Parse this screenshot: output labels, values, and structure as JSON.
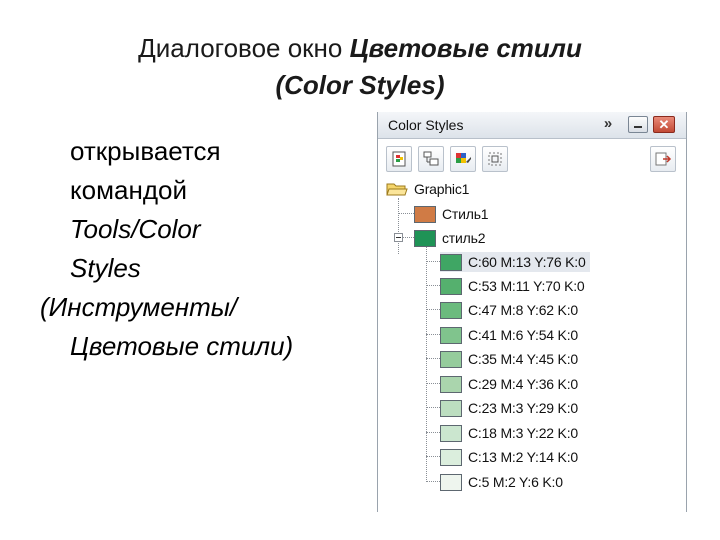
{
  "slide": {
    "title_prefix": "Диалоговое окно ",
    "title_italic": "Цветовые стили",
    "title_line2": "(Color Styles)",
    "body": [
      {
        "text": "открывается",
        "style": "normal"
      },
      {
        "text": "командой",
        "style": "normal"
      },
      {
        "text": "Tools/Color",
        "style": "italic"
      },
      {
        "text": "Styles",
        "style": "italic"
      },
      {
        "text": "(Инструменты/",
        "style": "italic-outdent"
      },
      {
        "text": "Цветовые стили)",
        "style": "italic"
      }
    ]
  },
  "panel": {
    "title": "Color Styles",
    "chevron": "»",
    "close_glyph": "✕",
    "toolbar_icons": [
      "new-color-style-icon",
      "new-child-color-icon",
      "apply-color-style-icon",
      "convert-to-harmony-icon",
      "import-styles-icon"
    ],
    "tree": {
      "root_label": "Graphic1",
      "styles": [
        {
          "label": "Стиль1",
          "color": "#d07b45"
        },
        {
          "label": "стиль2",
          "color": "#1f9356",
          "children": [
            {
              "label": "C:60 M:13 Y:76 K:0",
              "color": "#3fa664"
            },
            {
              "label": "C:53 M:11 Y:70 K:0",
              "color": "#55b06e"
            },
            {
              "label": "C:47 M:8 Y:62 K:0",
              "color": "#6bbb7e"
            },
            {
              "label": "C:41 M:6 Y:54 K:0",
              "color": "#80c48d"
            },
            {
              "label": "C:35 M:4 Y:45 K:0",
              "color": "#95cc9c"
            },
            {
              "label": "C:29 M:4 Y:36 K:0",
              "color": "#aad5ad"
            },
            {
              "label": "C:23 M:3 Y:29 K:0",
              "color": "#bcdec0"
            },
            {
              "label": "C:18 M:3 Y:22 K:0",
              "color": "#cbe6cf"
            },
            {
              "label": "C:13 M:2 Y:14 K:0",
              "color": "#dbeedd"
            },
            {
              "label": "C:5 M:2 Y:6 K:0",
              "color": "#eef5ee"
            }
          ]
        }
      ]
    }
  }
}
